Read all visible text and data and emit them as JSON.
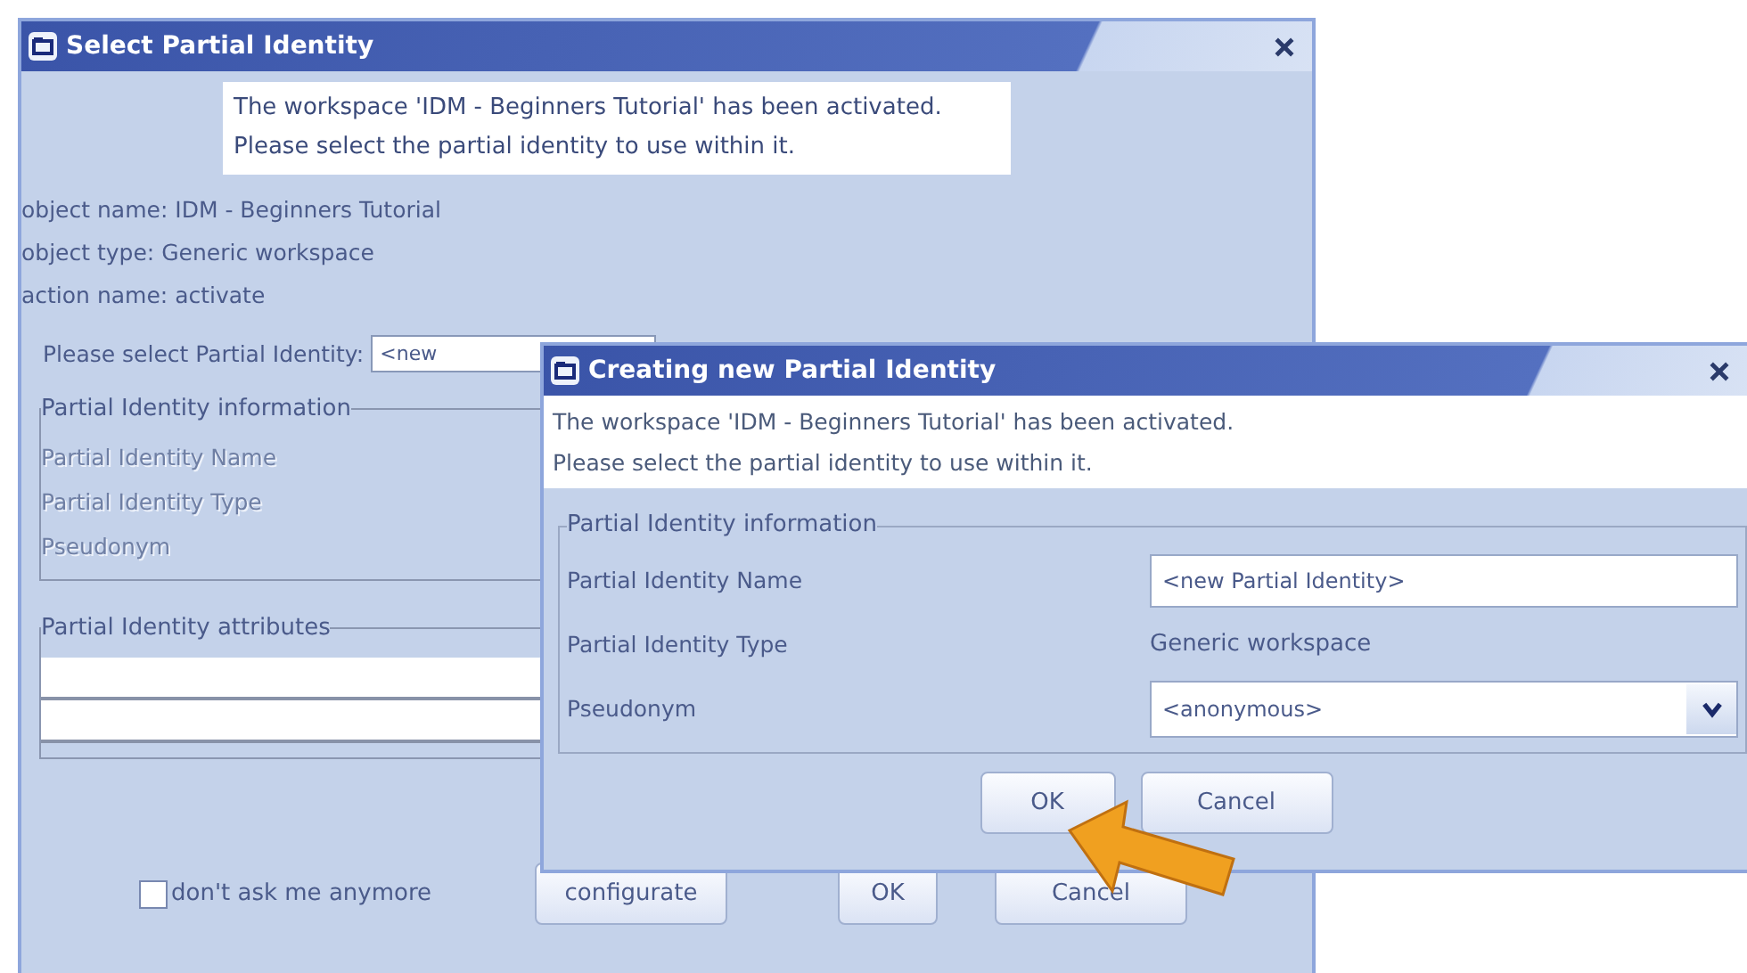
{
  "main_dialog": {
    "title": "Select Partial Identity",
    "message": [
      "The workspace 'IDM - Beginners Tutorial' has been activated.",
      "Please select the partial identity to use within it."
    ],
    "details": [
      "object name: IDM - Beginners Tutorial",
      "object type: Generic workspace",
      "action name: activate"
    ],
    "select_label": "Please select Partial Identity:",
    "select_value": "<new",
    "info_group": {
      "title": "Partial Identity information",
      "labels": [
        "Partial Identity Name",
        "Partial Identity Type",
        "Pseudonym"
      ]
    },
    "attributes_group": {
      "title": "Partial Identity attributes"
    },
    "dont_ask": {
      "label": "don't ask me anymore",
      "checked": false
    },
    "buttons": [
      "configurate",
      "OK",
      "Cancel"
    ]
  },
  "new_dialog": {
    "title": "Creating new Partial Identity",
    "message": [
      "The workspace 'IDM - Beginners Tutorial' has been activated.",
      "Please select the partial identity to use within it."
    ],
    "group_title": "Partial Identity information",
    "fields": [
      {
        "label": "Partial Identity Name",
        "kind": "input",
        "value": "<new Partial Identity>"
      },
      {
        "label": "Partial Identity Type",
        "kind": "text",
        "value": "Generic workspace"
      },
      {
        "label": "Pseudonym",
        "kind": "select",
        "value": "<anonymous>"
      }
    ],
    "buttons": [
      "OK",
      "Cancel"
    ]
  }
}
